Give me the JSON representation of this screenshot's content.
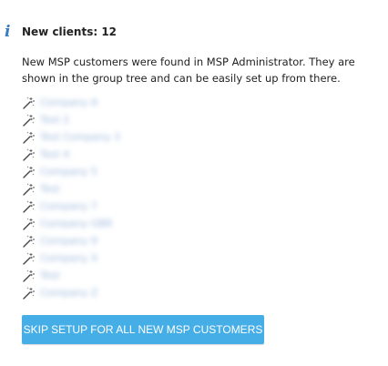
{
  "notice": {
    "icon": "info-icon",
    "icon_glyph": "i",
    "title": "New clients: 12",
    "description": "New MSP customers were found in MSP Administrator. They are shown in the group tree and can be easily set up from there."
  },
  "clients": [
    {
      "icon": "magic-wand-icon",
      "name": "Company A"
    },
    {
      "icon": "magic-wand-icon",
      "name": "Test 2"
    },
    {
      "icon": "magic-wand-icon",
      "name": "Test Company 3"
    },
    {
      "icon": "magic-wand-icon",
      "name": "Test 4"
    },
    {
      "icon": "magic-wand-icon",
      "name": "Company 5"
    },
    {
      "icon": "magic-wand-icon",
      "name": "Test"
    },
    {
      "icon": "magic-wand-icon",
      "name": "Company 7"
    },
    {
      "icon": "magic-wand-icon",
      "name": "Company GBR"
    },
    {
      "icon": "magic-wand-icon",
      "name": "Company 9"
    },
    {
      "icon": "magic-wand-icon",
      "name": "Company X"
    },
    {
      "icon": "magic-wand-icon",
      "name": "Test"
    },
    {
      "icon": "magic-wand-icon",
      "name": "Company Z"
    }
  ],
  "actions": {
    "skip_setup_label": "SKIP SETUP FOR ALL NEW MSP CUSTOMERS"
  },
  "colors": {
    "info_icon": "#3a7bc1",
    "client_link": "#9bb7db",
    "button_background": "#46aee6",
    "button_text": "#ffffff"
  }
}
